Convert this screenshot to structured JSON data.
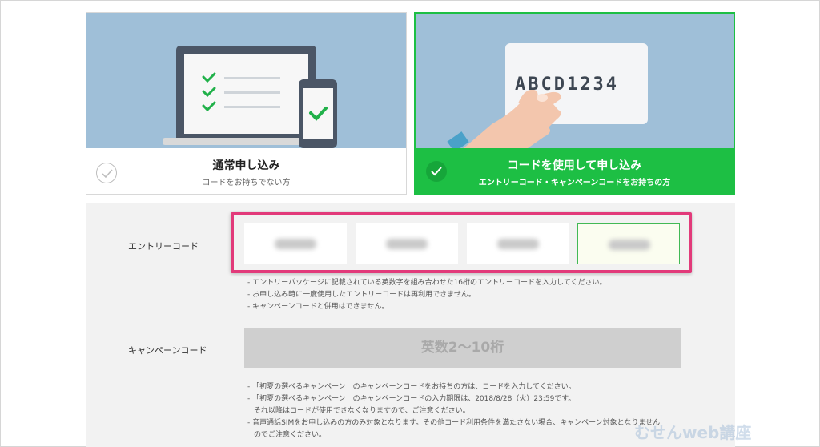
{
  "options": {
    "normal": {
      "title": "通常申し込み",
      "subtitle": "コードをお持ちでない方",
      "selected": false
    },
    "code": {
      "title": "コードを使用して申し込み",
      "subtitle": "エントリーコード・キャンペーンコードをお持ちの方",
      "selected": true,
      "card_text": "ABCD1234"
    }
  },
  "entry_code": {
    "label": "エントリーコード",
    "notes": [
      "- エントリーパッケージに記載されている英数字を組み合わせた16桁のエントリーコードを入力してください。",
      "- お申し込み時に一度使用したエントリーコードは再利用できません。",
      "- キャンペーンコードと併用はできません。"
    ]
  },
  "campaign_code": {
    "label": "キャンペーンコード",
    "placeholder": "英数2〜10桁",
    "notes": [
      "- 「初夏の選べるキャンペーン」のキャンペーンコードをお持ちの方は、コードを入力してください。",
      "- 「初夏の選べるキャンペーン」のキャンペーンコードの入力期限は、2018/8/28（火）23:59です。",
      "  それ以降はコードが使用できなくなりますので、ご注意ください。",
      "- 音声通話SIMをお申し込みの方のみ対象となります。その他コード利用条件を満たさない場合、キャンペーン対象となりません",
      "  のでご注意ください。"
    ]
  },
  "watermark": "むせんweb講座",
  "colors": {
    "green": "#1dbf44",
    "illustration_bg": "#9fbfd8",
    "highlight": "#e23a7a",
    "panel_bg": "#f2f2f2"
  }
}
